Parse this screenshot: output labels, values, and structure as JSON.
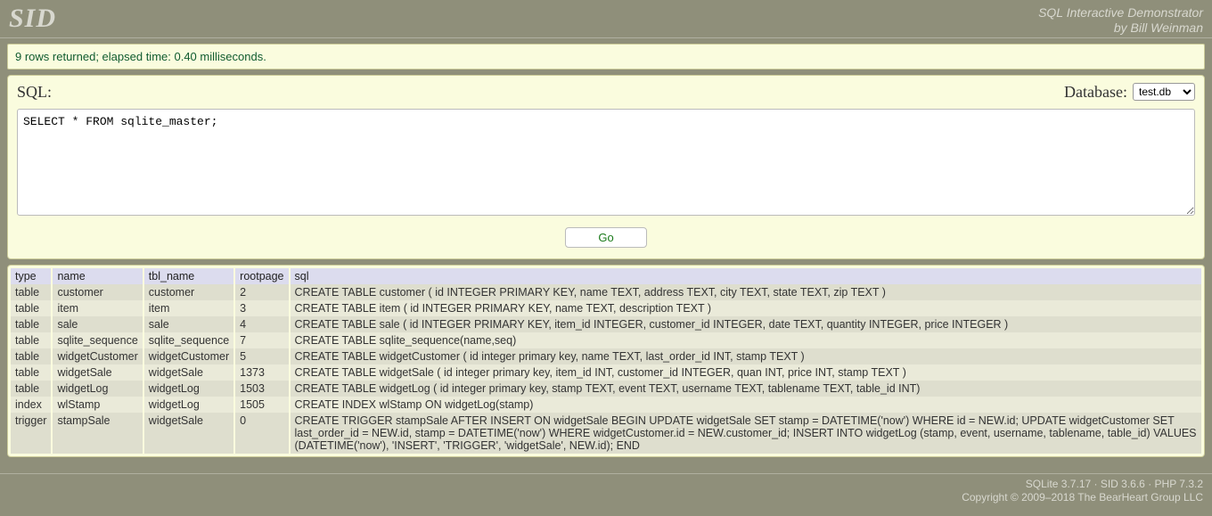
{
  "header": {
    "logo": "SID",
    "subtitle_line1": "SQL Interactive Demonstrator",
    "subtitle_line2": "by Bill Weinman"
  },
  "status": {
    "text": "9 rows returned; elapsed time: 0.40 milliseconds."
  },
  "sql_panel": {
    "label": "SQL:",
    "database_label": "Database:",
    "database_selected": "test.db",
    "query": "SELECT * FROM sqlite_master;",
    "go_label": "Go"
  },
  "results": {
    "columns": [
      "type",
      "name",
      "tbl_name",
      "rootpage",
      "sql"
    ],
    "rows": [
      {
        "type": "table",
        "name": "customer",
        "tbl_name": "customer",
        "rootpage": "2",
        "sql": "CREATE TABLE customer ( id INTEGER PRIMARY KEY, name TEXT, address TEXT, city TEXT, state TEXT, zip TEXT )"
      },
      {
        "type": "table",
        "name": "item",
        "tbl_name": "item",
        "rootpage": "3",
        "sql": "CREATE TABLE item ( id INTEGER PRIMARY KEY, name TEXT, description TEXT )"
      },
      {
        "type": "table",
        "name": "sale",
        "tbl_name": "sale",
        "rootpage": "4",
        "sql": "CREATE TABLE sale ( id INTEGER PRIMARY KEY, item_id INTEGER, customer_id INTEGER, date TEXT, quantity INTEGER, price INTEGER )"
      },
      {
        "type": "table",
        "name": "sqlite_sequence",
        "tbl_name": "sqlite_sequence",
        "rootpage": "7",
        "sql": "CREATE TABLE sqlite_sequence(name,seq)"
      },
      {
        "type": "table",
        "name": "widgetCustomer",
        "tbl_name": "widgetCustomer",
        "rootpage": "5",
        "sql": "CREATE TABLE widgetCustomer ( id integer primary key, name TEXT, last_order_id INT, stamp TEXT )"
      },
      {
        "type": "table",
        "name": "widgetSale",
        "tbl_name": "widgetSale",
        "rootpage": "1373",
        "sql": "CREATE TABLE widgetSale ( id integer primary key, item_id INT, customer_id INTEGER, quan INT, price INT, stamp TEXT )"
      },
      {
        "type": "table",
        "name": "widgetLog",
        "tbl_name": "widgetLog",
        "rootpage": "1503",
        "sql": "CREATE TABLE widgetLog ( id integer primary key, stamp TEXT, event TEXT, username TEXT, tablename TEXT, table_id INT)"
      },
      {
        "type": "index",
        "name": "wlStamp",
        "tbl_name": "widgetLog",
        "rootpage": "1505",
        "sql": "CREATE INDEX wlStamp ON widgetLog(stamp)"
      },
      {
        "type": "trigger",
        "name": "stampSale",
        "tbl_name": "widgetSale",
        "rootpage": "0",
        "sql": "CREATE TRIGGER stampSale AFTER INSERT ON widgetSale BEGIN UPDATE widgetSale SET stamp = DATETIME('now') WHERE id = NEW.id; UPDATE widgetCustomer SET last_order_id = NEW.id, stamp = DATETIME('now') WHERE widgetCustomer.id = NEW.customer_id; INSERT INTO widgetLog (stamp, event, username, tablename, table_id) VALUES (DATETIME('now'), 'INSERT', 'TRIGGER', 'widgetSale', NEW.id); END"
      }
    ]
  },
  "footer": {
    "line1": "SQLite 3.7.17 · SID 3.6.6 · PHP 7.3.2",
    "line2": "Copyright © 2009–2018 The BearHeart Group LLC"
  }
}
